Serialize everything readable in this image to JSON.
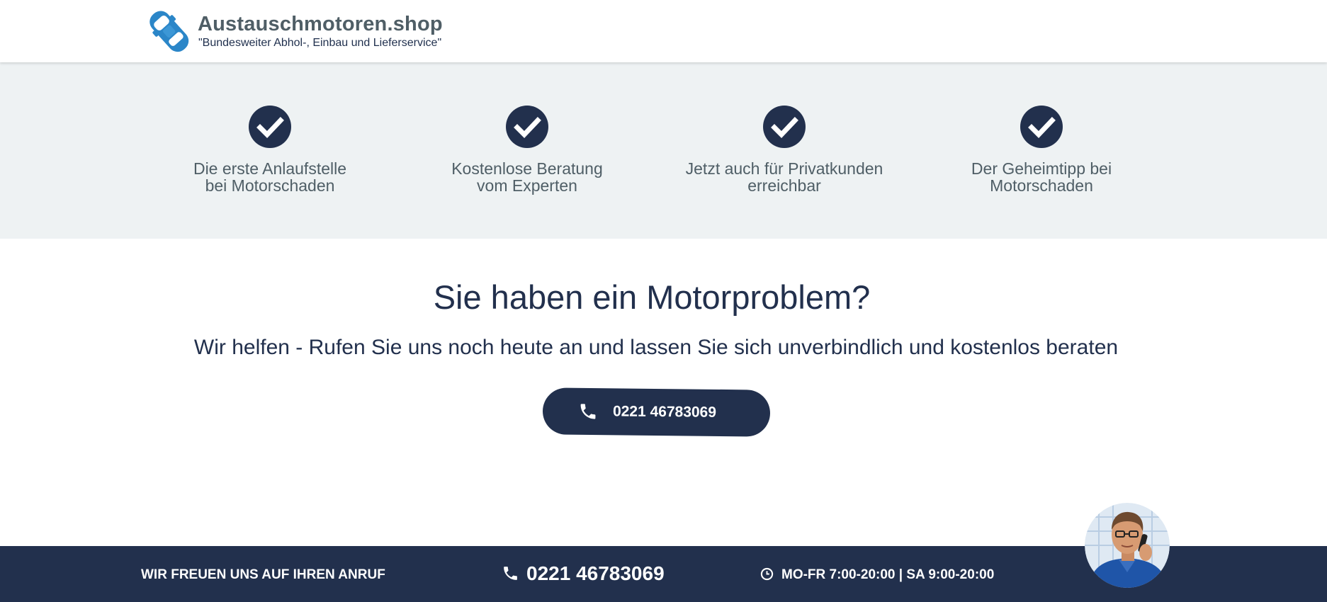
{
  "header": {
    "logo_title": "Austauschmotoren.shop",
    "logo_tagline": "\"Bundesweiter Abhol-, Einbau und Lieferservice\"",
    "logo_icon": "car-icon"
  },
  "features": {
    "icon": "check-circle-icon",
    "items": [
      {
        "text": "Die erste Anlaufstelle\nbei Motorschaden"
      },
      {
        "text": "Kostenlose Beratung\nvom Experten"
      },
      {
        "text": "Jetzt auch für Privatkunden\nerreichbar"
      },
      {
        "text": "Der Geheimtipp bei\nMotorschaden"
      }
    ]
  },
  "main": {
    "headline": "Sie haben ein Motorproblem?",
    "subline": "Wir helfen - Rufen Sie uns noch heute an und lassen Sie sich unverbindlich und kostenlos beraten",
    "cta_phone": "0221 46783069",
    "cta_icon": "phone-icon"
  },
  "footer": {
    "call_text": "WIR FREUEN UNS AUF IHREN ANRUF",
    "phone": "0221 46783069",
    "hours": "MO-FR 7:00-20:00 | SA 9:00-20:00",
    "phone_icon": "phone-icon",
    "clock_icon": "clock-icon",
    "avatar": "support-person-avatar"
  },
  "colors": {
    "navy": "#22304d",
    "logo_blue": "#2b86c8",
    "band_bg": "#eef2f3",
    "text_gray": "#4f5e66"
  }
}
